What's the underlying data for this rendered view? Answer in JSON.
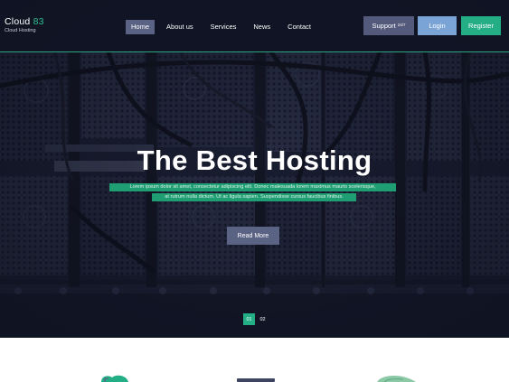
{
  "logo": {
    "name": "Cloud",
    "accent": "83",
    "tagline": "Cloud Hosting"
  },
  "nav": {
    "items": [
      {
        "label": "Home",
        "active": true
      },
      {
        "label": "About us",
        "active": false
      },
      {
        "label": "Services",
        "active": false
      },
      {
        "label": "News",
        "active": false
      },
      {
        "label": "Contact",
        "active": false
      }
    ]
  },
  "header_buttons": {
    "support_label": "Support",
    "support_hours": "24/7",
    "login_label": "Login",
    "register_label": "Register"
  },
  "hero": {
    "title": "The Best Hosting",
    "description_line1": "Lorem ipsum dolor sit amet, consectetur adipiscing elit. Donec malesuada lorem maximus mauris scelerisque,",
    "description_line2": "at rutrum nulla dictum. Ut ac ligula sapien. Suspendisse cursus faucibus finibus.",
    "read_more_label": "Read More"
  },
  "slider": {
    "pages": [
      "01",
      "02"
    ],
    "active_index": 0
  },
  "colors": {
    "accent_green": "#24ae85",
    "nav_active": "#5b6384",
    "login_blue": "#7aa4d6",
    "hero_dark": "#1d2236"
  }
}
